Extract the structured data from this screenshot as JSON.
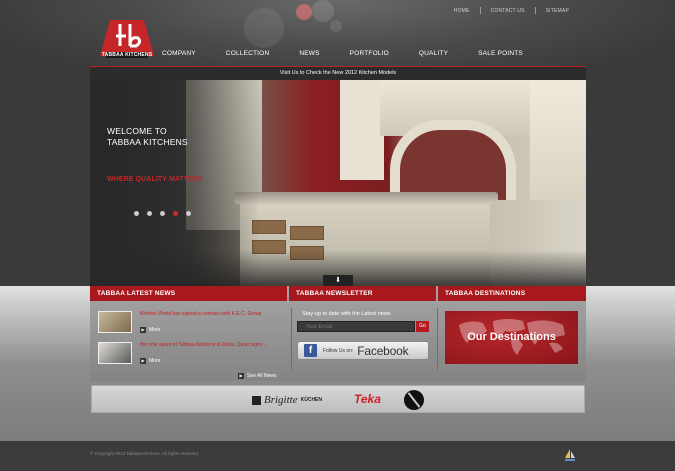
{
  "header": {
    "logo_text": "TABBAA KITCHENS",
    "top_links": [
      "HOME",
      "CONTACT US",
      "SITEMAP"
    ],
    "nav": [
      "COMPANY",
      "COLLECTION",
      "NEWS",
      "PORTFOLIO",
      "QUALITY",
      "SALE POINTS"
    ],
    "promo": "Visit Us to Check the New 2012 Kitchen Models"
  },
  "hero": {
    "title_line1": "WELCOME TO",
    "title_line2": "TABBAA KITCHENS",
    "subtitle": "WHERE QUALITY MATTERS",
    "slides_count": 5,
    "active_slide": 4
  },
  "sections": {
    "news_title": "TABBAA LATEST NEWS",
    "newsletter_title": "TABBAA NEWSLETTER",
    "destinations_title": "TABBAA DESTINATIONS"
  },
  "news": {
    "items": [
      {
        "text": "Kitchen World has signed a contract with K.E.C. Group",
        "more": "More"
      },
      {
        "text": "the sole agent of Tabbaa Kitchens in Doha, Qatar signs ...",
        "more": "More"
      }
    ],
    "see_all": "See All News"
  },
  "newsletter": {
    "label": "Stay-up to date with the Latest news",
    "email_placeholder": "Your Email",
    "go_label": "Go",
    "facebook_follow": "Follow Us on:",
    "facebook_name": "Facebook"
  },
  "destinations": {
    "label": "Our Destinations"
  },
  "brands": {
    "brigitte": "Brigitte",
    "brigitte_sub": "KÜCHEN",
    "teka": "Teka"
  },
  "footer": {
    "copyright": "© Copyright 2012 Tabbaa Kitchens. All rights reserved."
  },
  "colors": {
    "brand_red": "#a8191e",
    "accent_red": "#c4262a",
    "facebook_blue": "#3b5998"
  }
}
